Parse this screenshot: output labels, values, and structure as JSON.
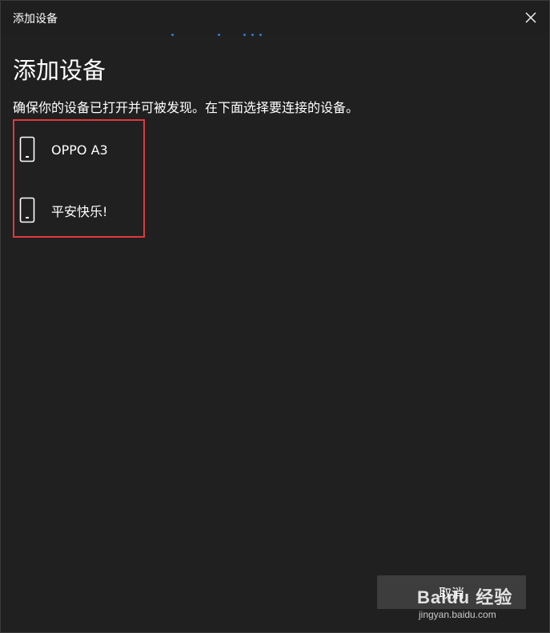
{
  "window": {
    "title": "添加设备"
  },
  "main": {
    "heading": "添加设备",
    "instruction": "确保你的设备已打开并可被发现。在下面选择要连接的设备。",
    "devices": [
      {
        "name": "OPPO A3",
        "icon": "phone-icon"
      },
      {
        "name": "平安快乐!",
        "icon": "phone-icon"
      }
    ]
  },
  "footer": {
    "cancel_label": "取消"
  },
  "watermark": {
    "text": "Baidu 经验",
    "url": "jingyan.baidu.com"
  },
  "colors": {
    "background": "#202020",
    "highlight_border": "#e0393e",
    "progress_accent": "#2d7fd9",
    "button_bg": "#3d3d3d"
  }
}
